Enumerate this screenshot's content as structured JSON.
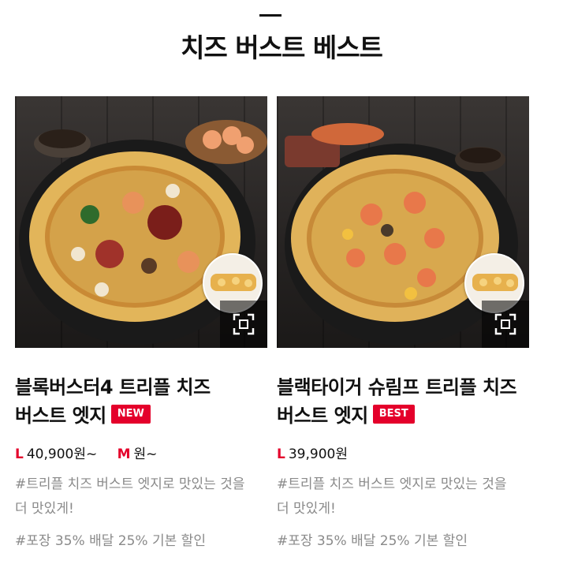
{
  "section": {
    "title": "치즈 버스트 베스트"
  },
  "products": [
    {
      "name": "블록버스터4 트리플 치즈 버스트 엣지",
      "badge": "NEW",
      "prices": [
        {
          "size": "L",
          "amount": "40,900원~"
        },
        {
          "size": "M",
          "amount": "원~"
        }
      ],
      "description": "#트리플 치즈 버스트 엣지로 맛있는 것을 더 맛있게!",
      "promo": "#포장 35% 배달 25% 기본 할인"
    },
    {
      "name": "블랙타이거 슈림프 트리플 치즈 버스트 엣지",
      "badge": "BEST",
      "prices": [
        {
          "size": "L",
          "amount": "39,900원"
        }
      ],
      "description": "#트리플 치즈 버스트 엣지로 맛있는 것을 더 맛있게!",
      "promo": "#포장 35% 배달 25% 기본 할인"
    }
  ],
  "colors": {
    "accent": "#e4002b",
    "muted": "#8a8a8a"
  },
  "icons": {
    "zoom": "expand-icon"
  }
}
